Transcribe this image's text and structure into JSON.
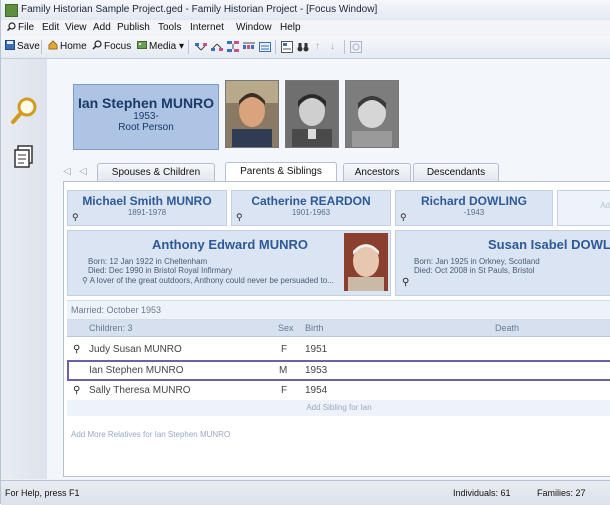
{
  "window": {
    "title": "Family Historian Sample Project.ged - Family Historian Project - [Focus Window]"
  },
  "menu": [
    "File",
    "Edit",
    "View",
    "Add",
    "Publish",
    "Tools",
    "Internet",
    "Window",
    "Help"
  ],
  "toolbar": {
    "save": "Save",
    "home": "Home",
    "focus": "Focus",
    "media": "Media"
  },
  "root": {
    "name": "Ian Stephen MUNRO",
    "years": "1953-",
    "label": "Root Person"
  },
  "tabs": [
    "Spouses & Children",
    "Parents & Siblings",
    "Ancestors",
    "Descendants"
  ],
  "grandparents": [
    {
      "name": "Michael Smith MUNRO",
      "years": "1891-1978"
    },
    {
      "name": "Catherine REARDON",
      "years": "1901-1963"
    },
    {
      "name": "Richard DOWLING",
      "years": "-1943"
    },
    {
      "name": "Ad",
      "years": ""
    }
  ],
  "father": {
    "name": "Anthony Edward MUNRO",
    "born_label": "Born:",
    "born": "12 Jan 1922 in Cheltenham",
    "died_label": "Died:",
    "died": "Dec 1990 in Bristol Royal Infirmary",
    "note": "A lover of the great outdoors, Anthony could never be persuaded to..."
  },
  "mother": {
    "name": "Susan Isabel DOWLIN",
    "born_label": "Born:",
    "born": "Jan 1925 in Orkney, Scotland",
    "died_label": "Died:",
    "died": "Oct 2008 in St Pauls, Bristol"
  },
  "family": {
    "married": "Married: October 1953",
    "columns": {
      "children": "Children: 3",
      "sex": "Sex",
      "birth": "Birth",
      "death": "Death"
    },
    "children": [
      {
        "name": "Judy Susan MUNRO",
        "sex": "F",
        "birth": "1951"
      },
      {
        "name": "Ian Stephen MUNRO",
        "sex": "M",
        "birth": "1953"
      },
      {
        "name": "Sally Theresa MUNRO",
        "sex": "F",
        "birth": "1954"
      }
    ],
    "add_sibling": "Add Sibling for Ian",
    "add_more": "Add More Relatives for Ian Stephen MUNRO"
  },
  "status": {
    "help": "For Help, press F1",
    "individuals": "Individuals: 61",
    "families": "Families: 27"
  },
  "colors": {
    "root_box": "#aec4e4",
    "relative_box": "#dbe4f2",
    "name_text": "#2d5a96",
    "selection": "#6f5fa8"
  }
}
